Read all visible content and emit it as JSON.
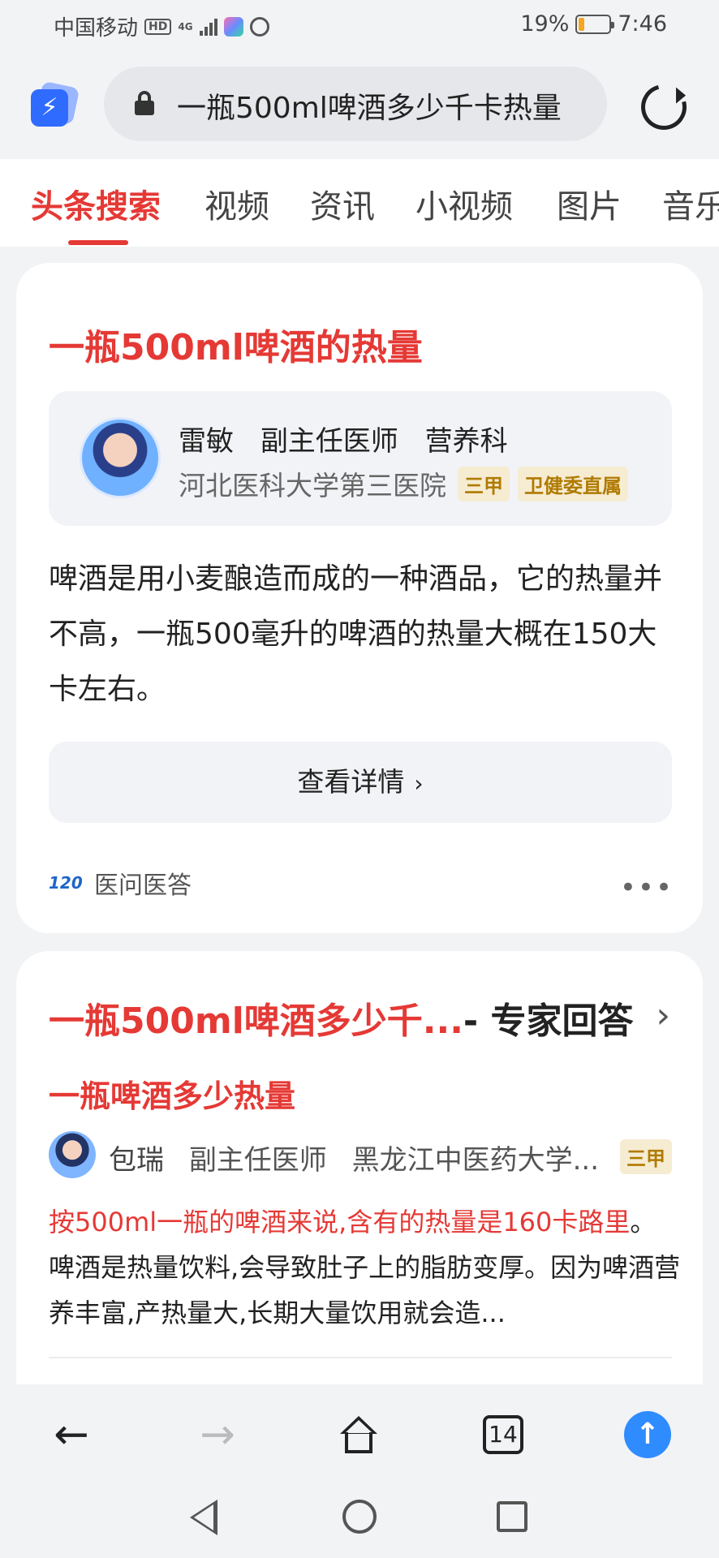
{
  "status_bar": {
    "carrier": "中国移动",
    "hd": "HD",
    "network": "4G",
    "battery": "19%",
    "time": "7:46"
  },
  "address_bar": {
    "query": "一瓶500ml啤酒多少千卡热量"
  },
  "tabs": [
    "头条搜索",
    "视频",
    "资讯",
    "小视频",
    "图片",
    "音乐"
  ],
  "card1": {
    "title": "一瓶500ml啤酒的热量",
    "doctor": {
      "name": "雷敏",
      "title": "副主任医师",
      "department": "营养科",
      "hospital": "河北医科大学第三医院",
      "badges": [
        "三甲",
        "卫健委直属"
      ]
    },
    "body": "啤酒是用小麦酿造而成的一种酒品，它的热量并不高，一瓶500毫升的啤酒的热量大概在150大卡左右。",
    "detail_button": "查看详情",
    "source_logo": "120",
    "source": "医问医答",
    "more": "•••"
  },
  "card2": {
    "title_red": "一瓶500ml啤酒多少千...",
    "title_dark": "- 专家回答",
    "subtitle": "一瓶啤酒多少热量",
    "doctor": {
      "name": "包瑞",
      "title": "副主任医师",
      "hospital": "黑龙江中医药大学...",
      "badge": "三甲"
    },
    "body_highlight": "按500ml一瓶的啤酒来说,含有的热量是160卡路里",
    "body_rest": "。啤酒是热量饮料,会导致肚子上的脂肪变厚。因为啤酒营养丰富,产热量大,长期大量饮用就会造..."
  },
  "toolbar": {
    "tab_count": "14"
  },
  "colors": {
    "accent_red": "#e53935",
    "badge_gold": "#b07a00",
    "up_blue": "#2f8cff"
  }
}
